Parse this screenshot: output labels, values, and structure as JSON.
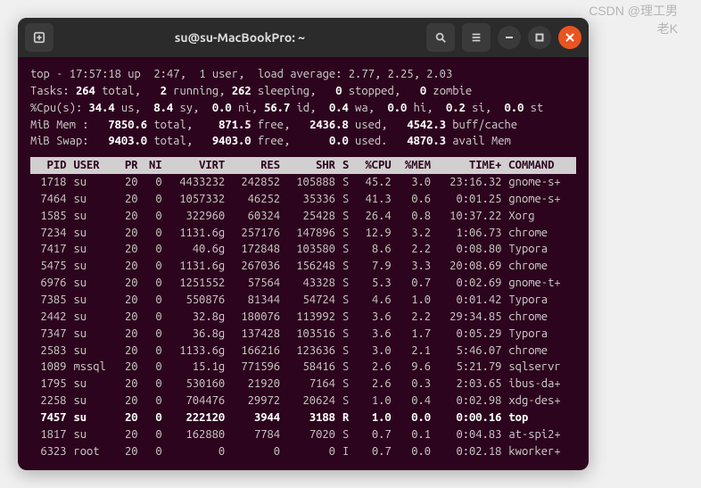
{
  "window": {
    "title": "su@su-MacBookPro: ~"
  },
  "summary": {
    "line1": {
      "time": "17:57:18",
      "up": "2:47",
      "users": "1 user",
      "load": "2.77, 2.25, 2.03"
    },
    "tasks": {
      "total": "264",
      "running": "2",
      "sleeping": "262",
      "stopped": "0",
      "zombie": "0"
    },
    "cpu": {
      "us": "34.4",
      "sy": "8.4",
      "ni": "0.0",
      "id": "56.7",
      "wa": "0.4",
      "hi": "0.0",
      "si": "0.2",
      "st": "0.0"
    },
    "mem": {
      "total": "7850.6",
      "free": "871.5",
      "used": "2436.8",
      "buffcache": "4542.3"
    },
    "swap": {
      "total": "9403.0",
      "free": "9403.0",
      "used": "0.0",
      "avail": "4870.3"
    }
  },
  "columns": [
    "PID",
    "USER",
    "PR",
    "NI",
    "VIRT",
    "RES",
    "SHR",
    "S",
    "%CPU",
    "%MEM",
    "TIME+",
    "COMMAND"
  ],
  "rows": [
    {
      "pid": "1718",
      "user": "su",
      "pr": "20",
      "ni": "0",
      "virt": "4433232",
      "res": "242852",
      "shr": "105888",
      "s": "S",
      "cpu": "45.2",
      "mem": "3.0",
      "time": "23:16.32",
      "cmd": "gnome-s+",
      "hi": false
    },
    {
      "pid": "7464",
      "user": "su",
      "pr": "20",
      "ni": "0",
      "virt": "1057332",
      "res": "46252",
      "shr": "35336",
      "s": "S",
      "cpu": "41.3",
      "mem": "0.6",
      "time": "0:01.25",
      "cmd": "gnome-s+",
      "hi": false
    },
    {
      "pid": "1585",
      "user": "su",
      "pr": "20",
      "ni": "0",
      "virt": "322960",
      "res": "60324",
      "shr": "25428",
      "s": "S",
      "cpu": "26.4",
      "mem": "0.8",
      "time": "10:37.22",
      "cmd": "Xorg",
      "hi": false
    },
    {
      "pid": "7234",
      "user": "su",
      "pr": "20",
      "ni": "0",
      "virt": "1131.6g",
      "res": "257176",
      "shr": "147896",
      "s": "S",
      "cpu": "12.9",
      "mem": "3.2",
      "time": "1:06.73",
      "cmd": "chrome",
      "hi": false
    },
    {
      "pid": "7417",
      "user": "su",
      "pr": "20",
      "ni": "0",
      "virt": "40.6g",
      "res": "172848",
      "shr": "103580",
      "s": "S",
      "cpu": "8.6",
      "mem": "2.2",
      "time": "0:08.80",
      "cmd": "Typora",
      "hi": false
    },
    {
      "pid": "5475",
      "user": "su",
      "pr": "20",
      "ni": "0",
      "virt": "1131.6g",
      "res": "267036",
      "shr": "156248",
      "s": "S",
      "cpu": "7.9",
      "mem": "3.3",
      "time": "20:08.69",
      "cmd": "chrome",
      "hi": false
    },
    {
      "pid": "6976",
      "user": "su",
      "pr": "20",
      "ni": "0",
      "virt": "1251552",
      "res": "57564",
      "shr": "43328",
      "s": "S",
      "cpu": "5.3",
      "mem": "0.7",
      "time": "0:02.69",
      "cmd": "gnome-t+",
      "hi": false
    },
    {
      "pid": "7385",
      "user": "su",
      "pr": "20",
      "ni": "0",
      "virt": "550876",
      "res": "81344",
      "shr": "54724",
      "s": "S",
      "cpu": "4.6",
      "mem": "1.0",
      "time": "0:01.42",
      "cmd": "Typora",
      "hi": false
    },
    {
      "pid": "2442",
      "user": "su",
      "pr": "20",
      "ni": "0",
      "virt": "32.8g",
      "res": "180076",
      "shr": "113992",
      "s": "S",
      "cpu": "3.6",
      "mem": "2.2",
      "time": "29:34.85",
      "cmd": "chrome",
      "hi": false
    },
    {
      "pid": "7347",
      "user": "su",
      "pr": "20",
      "ni": "0",
      "virt": "36.8g",
      "res": "137428",
      "shr": "103516",
      "s": "S",
      "cpu": "3.6",
      "mem": "1.7",
      "time": "0:05.29",
      "cmd": "Typora",
      "hi": false
    },
    {
      "pid": "2583",
      "user": "su",
      "pr": "20",
      "ni": "0",
      "virt": "1133.6g",
      "res": "166216",
      "shr": "123636",
      "s": "S",
      "cpu": "3.0",
      "mem": "2.1",
      "time": "5:46.07",
      "cmd": "chrome",
      "hi": false
    },
    {
      "pid": "1089",
      "user": "mssql",
      "pr": "20",
      "ni": "0",
      "virt": "15.1g",
      "res": "771596",
      "shr": "58416",
      "s": "S",
      "cpu": "2.6",
      "mem": "9.6",
      "time": "5:21.79",
      "cmd": "sqlservr",
      "hi": false
    },
    {
      "pid": "1795",
      "user": "su",
      "pr": "20",
      "ni": "0",
      "virt": "530160",
      "res": "21920",
      "shr": "7164",
      "s": "S",
      "cpu": "2.6",
      "mem": "0.3",
      "time": "2:03.65",
      "cmd": "ibus-da+",
      "hi": false
    },
    {
      "pid": "2258",
      "user": "su",
      "pr": "20",
      "ni": "0",
      "virt": "704476",
      "res": "29972",
      "shr": "20624",
      "s": "S",
      "cpu": "1.0",
      "mem": "0.4",
      "time": "0:02.98",
      "cmd": "xdg-des+",
      "hi": false
    },
    {
      "pid": "7457",
      "user": "su",
      "pr": "20",
      "ni": "0",
      "virt": "222120",
      "res": "3944",
      "shr": "3188",
      "s": "R",
      "cpu": "1.0",
      "mem": "0.0",
      "time": "0:00.16",
      "cmd": "top",
      "hi": true
    },
    {
      "pid": "1817",
      "user": "su",
      "pr": "20",
      "ni": "0",
      "virt": "162880",
      "res": "7784",
      "shr": "7020",
      "s": "S",
      "cpu": "0.7",
      "mem": "0.1",
      "time": "0:04.83",
      "cmd": "at-spi2+",
      "hi": false
    },
    {
      "pid": "6323",
      "user": "root",
      "pr": "20",
      "ni": "0",
      "virt": "0",
      "res": "0",
      "shr": "0",
      "s": "I",
      "cpu": "0.7",
      "mem": "0.0",
      "time": "0:02.18",
      "cmd": "kworker+",
      "hi": false
    }
  ],
  "watermark": "CSDN @理工男老K"
}
